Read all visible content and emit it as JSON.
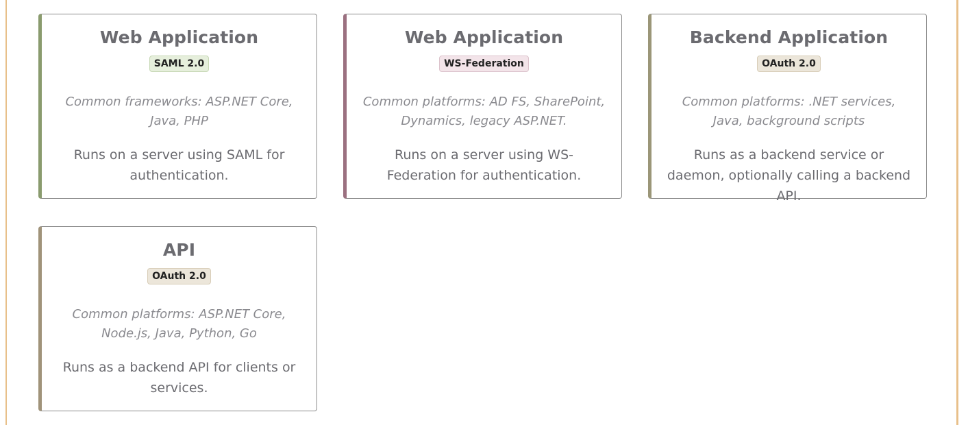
{
  "colors": {
    "frame_border": "#e8c08a",
    "saml_accent": "#8a9b6e",
    "wsfed_accent": "#9b7080",
    "oauth_backend_accent": "#9b9678",
    "oauth_api_accent": "#a0937a"
  },
  "cards": [
    {
      "title": "Web Application",
      "badge": "SAML 2.0",
      "platforms": "Common frameworks: ASP.NET Core, Java, PHP",
      "description": "Runs on a server using SAML for authentication."
    },
    {
      "title": "Web Application",
      "badge": "WS-Federation",
      "platforms": "Common platforms: AD FS, SharePoint, Dynamics, legacy ASP.NET.",
      "description": "Runs on a server using WS-Federation for authentication."
    },
    {
      "title": "Backend Application",
      "badge": "OAuth 2.0",
      "platforms": "Common platforms: .NET services, Java, background scripts",
      "description": "Runs as a backend service or daemon, optionally calling a backend API."
    },
    {
      "title": "API",
      "badge": "OAuth 2.0",
      "platforms": "Common platforms: ASP.NET Core, Node.js, Java, Python, Go",
      "description": "Runs as a backend API for clients or services."
    }
  ]
}
